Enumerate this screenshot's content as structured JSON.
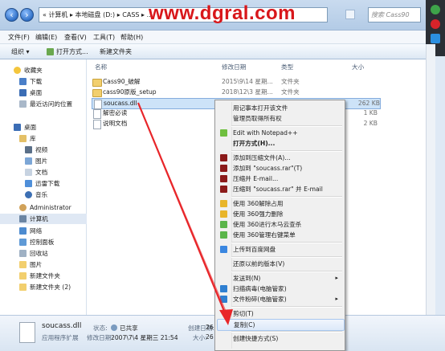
{
  "address": {
    "path": "« 计算机 ▸ 本地磁盘 (D:) ▸ CASS ▸ ...",
    "search_placeholder": "搜索 Cass90"
  },
  "watermark": "www.dgral.com",
  "menu": [
    "文件(F)",
    "编辑(E)",
    "查看(V)",
    "工具(T)",
    "帮助(H)"
  ],
  "toolbar": {
    "organize": "组织 ▾",
    "open": "打开方式...",
    "new_folder": "新建文件夹"
  },
  "nav": {
    "favorites": "收藏夹",
    "fav_items": [
      "下载",
      "桌面",
      "最近访问的位置"
    ],
    "desktop": "桌面",
    "libraries": "库",
    "lib_items": [
      "视频",
      "图片",
      "文档",
      "迅雷下载",
      "音乐"
    ],
    "admin": "Administrator",
    "computer": "计算机",
    "others": [
      "网络",
      "控制面板",
      "回收站",
      "图片",
      "新建文件夹",
      "新建文件夹 (2)"
    ]
  },
  "columns": {
    "name": "名称",
    "date": "修改日期",
    "type": "类型",
    "size": "大小"
  },
  "files": [
    {
      "name": "Cass90_破解",
      "date": "2015\\9\\14 星期...",
      "type": "文件夹",
      "size": ""
    },
    {
      "name": "cass90原版_setup",
      "date": "2018\\12\\3 星期...",
      "type": "文件夹",
      "size": ""
    },
    {
      "name": "soucass.dll",
      "date": "",
      "type": "",
      "size": "262 KB"
    },
    {
      "name": "解密必读",
      "date": "",
      "type": "",
      "size": "1 KB"
    },
    {
      "name": "说明文档",
      "date": "",
      "type": "",
      "size": "2 KB"
    }
  ],
  "details": {
    "filename": "soucass.dll",
    "filetype": "应用程序扩展",
    "state_label": "状态:",
    "state_value": "已共享",
    "modified_label": "修改日期:",
    "modified_value": "2007\\7\\4 星期三 21:54",
    "created_label": "创建日期:",
    "created_value": "26",
    "size_label": "大小:",
    "size_value": "26"
  },
  "context_menu": {
    "items": [
      {
        "label": "用记事本打开该文件",
        "icon": "",
        "bold": false
      },
      {
        "label": "管理员取得所有权",
        "icon": "",
        "bold": false
      },
      {
        "sep": true
      },
      {
        "label": "Edit with Notepad++",
        "icon": "notepadpp-icon",
        "bold": false
      },
      {
        "label": "打开方式(H)...",
        "icon": "",
        "bold": true
      },
      {
        "sep": true
      },
      {
        "label": "添加到压缩文件(A)...",
        "icon": "winrar-icon",
        "bold": false
      },
      {
        "label": "添加到 \"soucass.rar\"(T)",
        "icon": "winrar-icon",
        "bold": false
      },
      {
        "label": "压缩并 E-mail...",
        "icon": "winrar-icon",
        "bold": false
      },
      {
        "label": "压缩到 \"soucass.rar\" 并 E-mail",
        "icon": "winrar-icon",
        "bold": false
      },
      {
        "sep": true
      },
      {
        "label": "使用 360解除占用",
        "icon": "360-icon",
        "bold": false
      },
      {
        "label": "使用 360强力删除",
        "icon": "360-icon",
        "bold": false
      },
      {
        "label": "使用 360进行木马云查杀",
        "icon": "360-green-icon",
        "bold": false
      },
      {
        "label": "使用 360管理右键菜单",
        "icon": "360-green-icon",
        "bold": false
      },
      {
        "sep": true
      },
      {
        "label": "上传到百度网盘",
        "icon": "baidu-cloud-icon",
        "bold": false
      },
      {
        "sep": true
      },
      {
        "label": "还原以前的版本(V)",
        "icon": "",
        "bold": false
      },
      {
        "sep": true
      },
      {
        "label": "发送到(N)",
        "icon": "",
        "bold": false,
        "submenu": true
      },
      {
        "label": "扫描病毒(电脑管家)",
        "icon": "shield-icon",
        "bold": false
      },
      {
        "label": "文件粉碎(电脑管家)",
        "icon": "shield-icon",
        "bold": false,
        "submenu": true
      },
      {
        "sep": true
      },
      {
        "label": "剪切(T)",
        "icon": "",
        "bold": false
      },
      {
        "label": "复制(C)",
        "icon": "",
        "bold": false,
        "hover": true
      },
      {
        "sep": true
      },
      {
        "label": "创建快捷方式(S)",
        "icon": "",
        "bold": false
      }
    ]
  },
  "colors": {
    "accent": "#3a75c4",
    "arrow": "#e8262a",
    "winrar": "#8b1a1a",
    "c360": "#e8b52a"
  }
}
